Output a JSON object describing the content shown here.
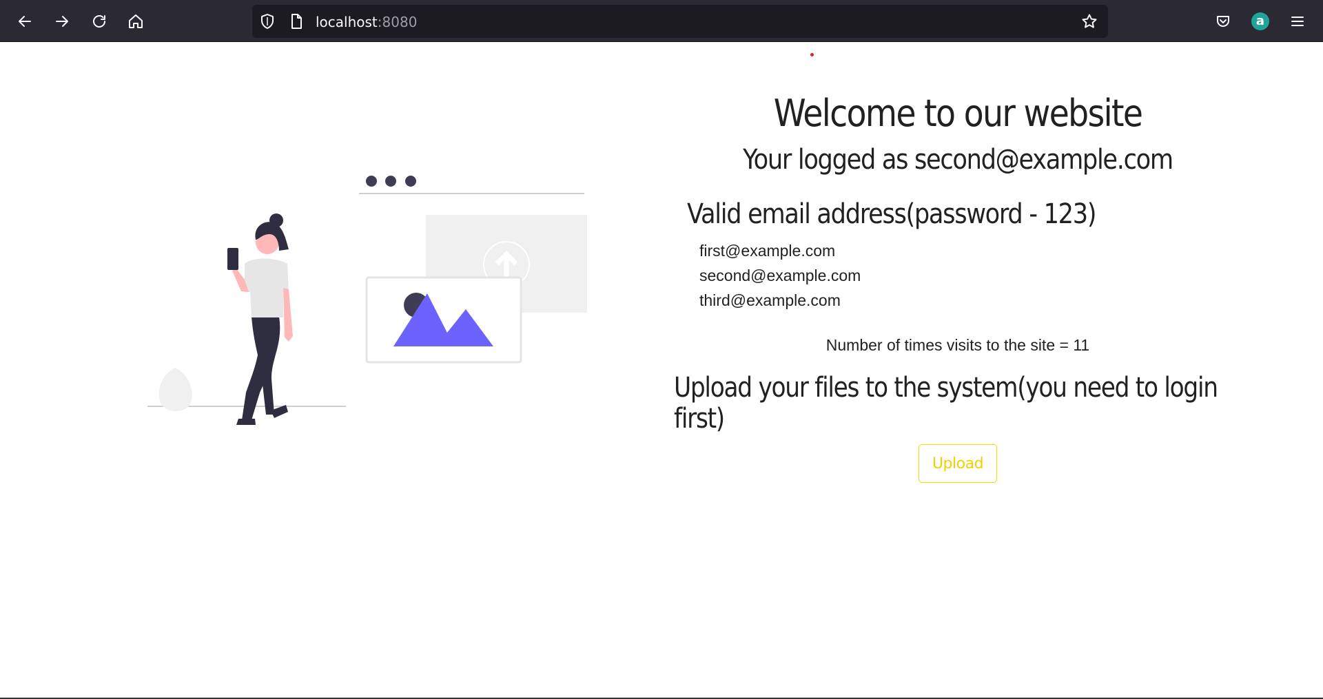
{
  "browser": {
    "url_host": "localhost",
    "url_port": ":8080",
    "account_initial": "a"
  },
  "page": {
    "title": "Welcome to our website",
    "logged_as": "Your logged as second@example.com",
    "emails_heading": "Valid email address(password - 123)",
    "emails": [
      "first@example.com",
      "second@example.com",
      "third@example.com"
    ],
    "visits_text": "Number of times visits to the site = 11",
    "upload_heading": "Upload your files to the system(you need to login first)",
    "upload_label": "Upload"
  },
  "colors": {
    "accent_yellow": "#f3db07",
    "illustration_purple": "#6c63ff",
    "toolbar_bg": "#2b2a33"
  },
  "icons": {
    "back": "back-arrow-icon",
    "forward": "forward-arrow-icon",
    "reload": "reload-icon",
    "home": "home-icon",
    "tracking": "shield-icon",
    "page": "page-icon",
    "bookmark": "star-icon",
    "pocket": "pocket-icon",
    "menu": "hamburger-menu-icon"
  }
}
